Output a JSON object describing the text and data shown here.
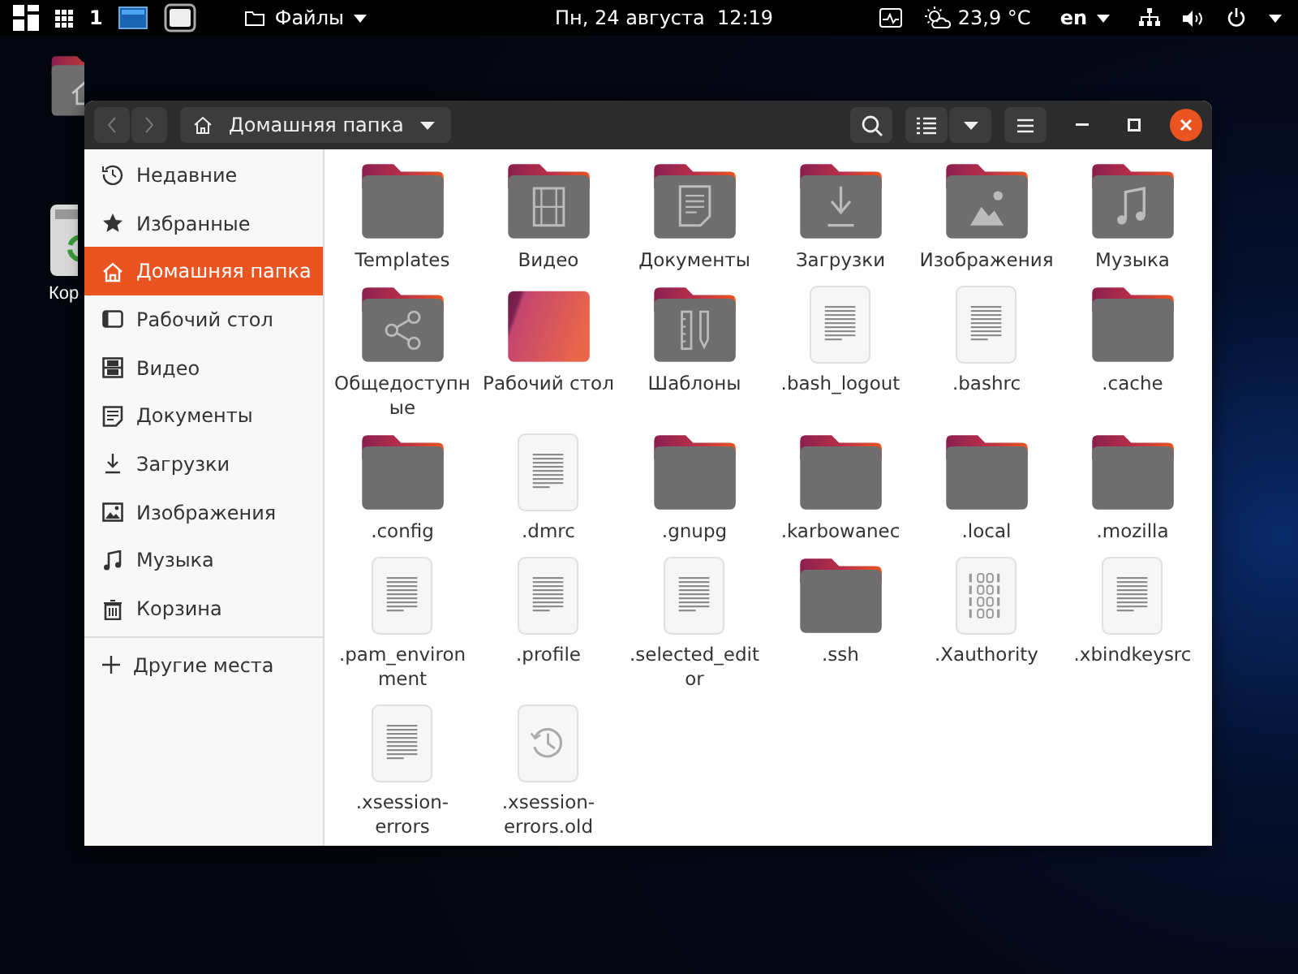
{
  "top_bar": {
    "workspace": "1",
    "app_menu": "Файлы",
    "clock": "Пн, 24 августа  12:19",
    "weather": "23,9 °C",
    "language": "en"
  },
  "desktop_icons": [
    {
      "kind": "home"
    },
    {
      "label": "Кор",
      "kind": "trash"
    }
  ],
  "window": {
    "path": "Домашняя папка"
  },
  "sidebar": {
    "items": [
      {
        "label": "Недавние",
        "kind": "recent",
        "selected": false
      },
      {
        "label": "Избранные",
        "kind": "starred",
        "selected": false
      },
      {
        "label": "Домашняя папка",
        "kind": "home",
        "selected": true
      },
      {
        "label": "Рабочий стол",
        "kind": "desktop",
        "selected": false
      },
      {
        "label": "Видео",
        "kind": "videos",
        "selected": false
      },
      {
        "label": "Документы",
        "kind": "documents",
        "selected": false
      },
      {
        "label": "Загрузки",
        "kind": "downloads",
        "selected": false
      },
      {
        "label": "Изображения",
        "kind": "pictures",
        "selected": false
      },
      {
        "label": "Музыка",
        "kind": "music",
        "selected": false
      },
      {
        "label": "Корзина",
        "kind": "trash",
        "selected": false
      }
    ],
    "other_locations": "Другие места"
  },
  "files": [
    {
      "name": "Templates",
      "kind": "folder"
    },
    {
      "name": "Видео",
      "kind": "video-folder"
    },
    {
      "name": "Документы",
      "kind": "documents-folder"
    },
    {
      "name": "Загрузки",
      "kind": "downloads-folder"
    },
    {
      "name": "Изображения",
      "kind": "pictures-folder"
    },
    {
      "name": "Музыка",
      "kind": "music-folder"
    },
    {
      "name": "Общедоступные",
      "kind": "shared-folder"
    },
    {
      "name": "Рабочий стол",
      "kind": "desktop-folder"
    },
    {
      "name": "Шаблоны",
      "kind": "templates-folder"
    },
    {
      "name": ".bash_logout",
      "kind": "text-file"
    },
    {
      "name": ".bashrc",
      "kind": "text-file"
    },
    {
      "name": ".cache",
      "kind": "folder"
    },
    {
      "name": ".config",
      "kind": "folder"
    },
    {
      "name": ".dmrc",
      "kind": "text-file"
    },
    {
      "name": ".gnupg",
      "kind": "folder"
    },
    {
      "name": ".karbowanec",
      "kind": "folder"
    },
    {
      "name": ".local",
      "kind": "folder"
    },
    {
      "name": ".mozilla",
      "kind": "folder"
    },
    {
      "name": ".pam_environment",
      "kind": "text-file"
    },
    {
      "name": ".profile",
      "kind": "text-file"
    },
    {
      "name": ".selected_editor",
      "kind": "text-file"
    },
    {
      "name": ".ssh",
      "kind": "folder"
    },
    {
      "name": ".Xauthority",
      "kind": "binary-file"
    },
    {
      "name": ".xbindkeysrc",
      "kind": "text-file"
    },
    {
      "name": ".xsession-errors",
      "kind": "text-file"
    },
    {
      "name": ".xsession-errors.old",
      "kind": "backup-file"
    }
  ]
}
